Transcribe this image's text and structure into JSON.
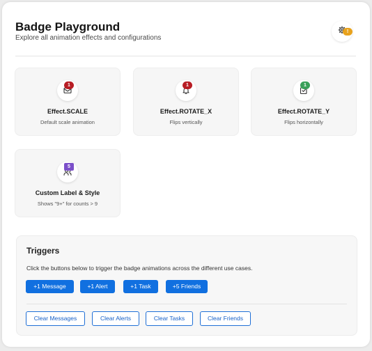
{
  "header": {
    "title": "Badge Playground",
    "subtitle": "Explore all animation effects and configurations",
    "settings_badge": "!"
  },
  "cards": [
    {
      "badge": "1",
      "title": "Effect.SCALE",
      "description": "Default scale animation",
      "icon": "mail-icon",
      "badge_color": "#b81d24"
    },
    {
      "badge": "1",
      "title": "Effect.ROTATE_X",
      "description": "Flips vertically",
      "icon": "bell-icon",
      "badge_color": "#b81d24"
    },
    {
      "badge": "1",
      "title": "Effect.ROTATE_Y",
      "description": "Flips horizontally",
      "icon": "check-square-icon",
      "badge_color": "#3aa05a"
    },
    {
      "badge": "5",
      "title": "Custom Label & Style",
      "description": "Shows \"9+\" for counts > 9",
      "icon": "users-icon",
      "badge_color": "#7b4fc9"
    }
  ],
  "triggers": {
    "title": "Triggers",
    "description": "Click the buttons below to trigger the badge animations across the different use cases.",
    "add_buttons": [
      "+1 Message",
      "+1 Alert",
      "+1 Task",
      "+5 Friends"
    ],
    "clear_buttons": [
      "Clear Messages",
      "Clear Alerts",
      "Clear Tasks",
      "Clear Friends"
    ]
  },
  "colors": {
    "primary": "#1170e0",
    "settings_badge": "#e8a21d"
  }
}
